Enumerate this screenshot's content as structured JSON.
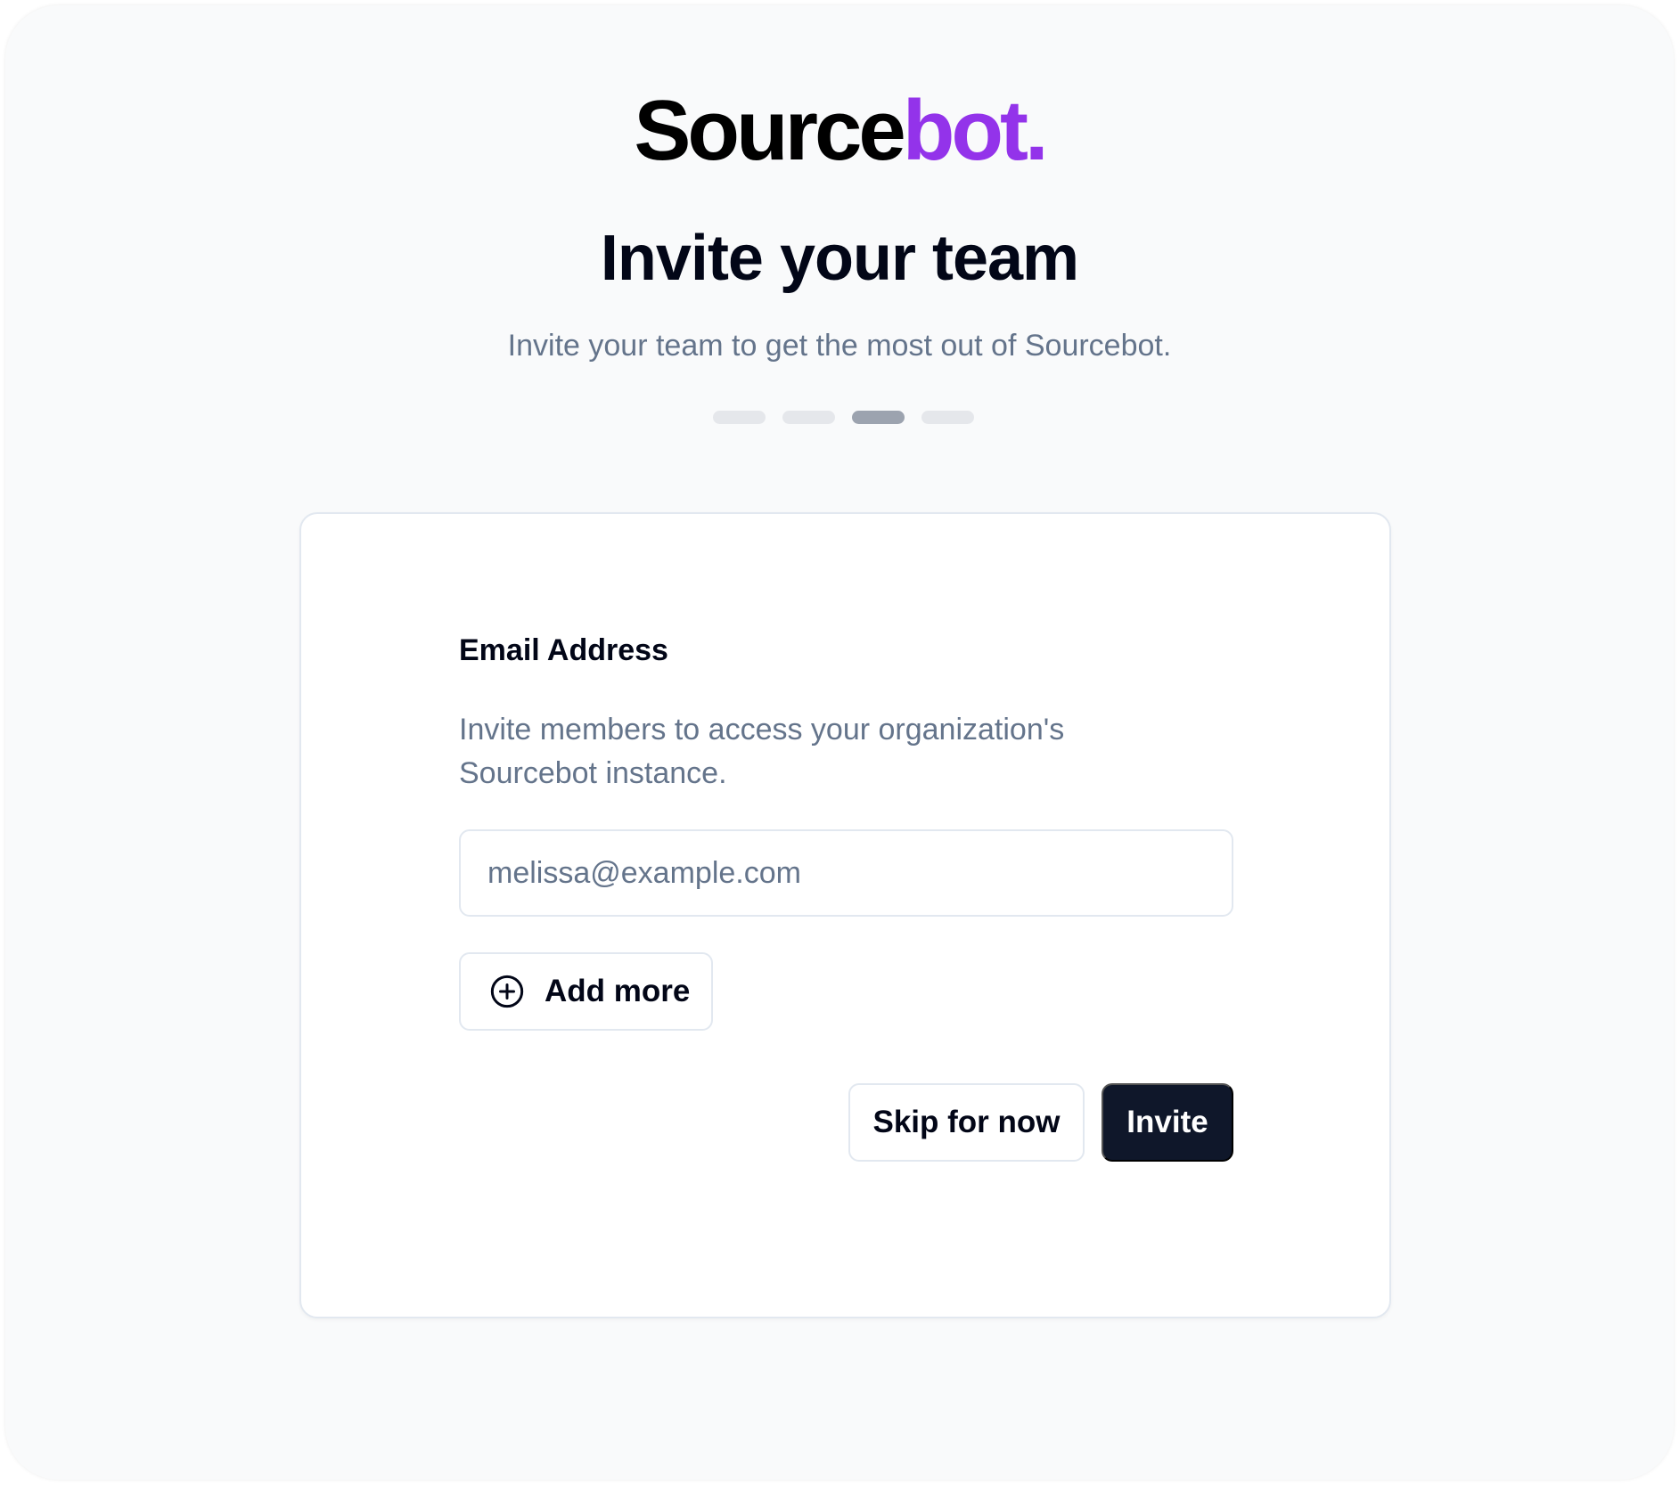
{
  "brand": {
    "name_part1": "Source",
    "name_part2": "bot.",
    "accent_color": "#9333ea"
  },
  "header": {
    "title": "Invite your team",
    "subtitle": "Invite your team to get the most out of Sourcebot."
  },
  "progress": {
    "total_steps": 4,
    "current_step": 3
  },
  "form": {
    "label": "Email Address",
    "description": "Invite members to access your organization's Sourcebot instance.",
    "email_placeholder": "melissa@example.com",
    "email_value": "",
    "add_more_label": "Add more",
    "add_more_icon": "plus-circle-icon",
    "skip_label": "Skip for now",
    "invite_label": "Invite"
  },
  "colors": {
    "primary_button": "#0f172a",
    "muted_text": "#64748b",
    "background": "#f9fafb"
  }
}
